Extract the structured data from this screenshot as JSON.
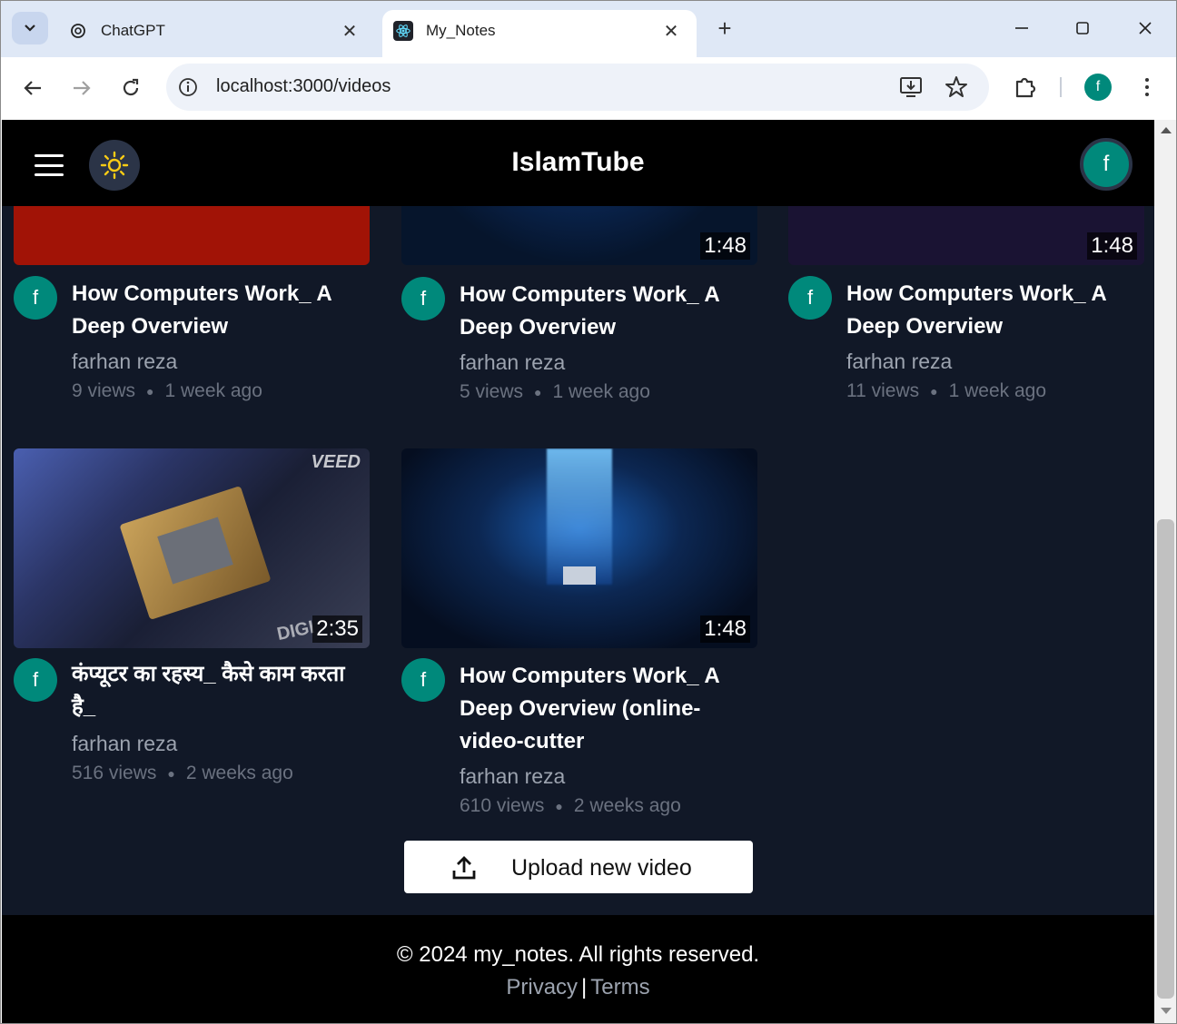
{
  "browser": {
    "tabs": [
      {
        "title": "ChatGPT",
        "icon": "chatgpt-icon",
        "active": false
      },
      {
        "title": "My_Notes",
        "icon": "react-icon",
        "active": true
      }
    ],
    "url": "localhost:3000/videos",
    "profile_initial": "f"
  },
  "app": {
    "brand": "IslamTube",
    "avatar_initial": "f",
    "accent": "#00897b"
  },
  "videos": [
    {
      "title": "How Computers Work_ A Deep Overview",
      "channel": "farhan reza",
      "views": "9 views",
      "age": "1 week ago",
      "duration": "",
      "avatar": "f"
    },
    {
      "title": "How Computers Work_ A Deep Overview",
      "channel": "farhan reza",
      "views": "5 views",
      "age": "1 week ago",
      "duration": "1:48",
      "avatar": "f"
    },
    {
      "title": "How Computers Work_ A Deep Overview",
      "channel": "farhan reza",
      "views": "11 views",
      "age": "1 week ago",
      "duration": "1:48",
      "avatar": "f"
    },
    {
      "title": "कंप्यूटर का रहस्य_ कैसे काम करता है_",
      "channel": "farhan reza",
      "views": "516 views",
      "age": "2 weeks ago",
      "duration": "2:35",
      "avatar": "f"
    },
    {
      "title": "How Computers Work_ A Deep Overview (online-video-cutter",
      "channel": "farhan reza",
      "views": "610 views",
      "age": "2 weeks ago",
      "duration": "1:48",
      "avatar": "f"
    }
  ],
  "thumb_overlay_text": {
    "veed": "VEED",
    "digi": "DIGI"
  },
  "upload_label": "Upload new video",
  "footer": {
    "copyright": "© 2024 my_notes. All rights reserved.",
    "privacy": "Privacy",
    "separator": "|",
    "terms": "Terms"
  }
}
